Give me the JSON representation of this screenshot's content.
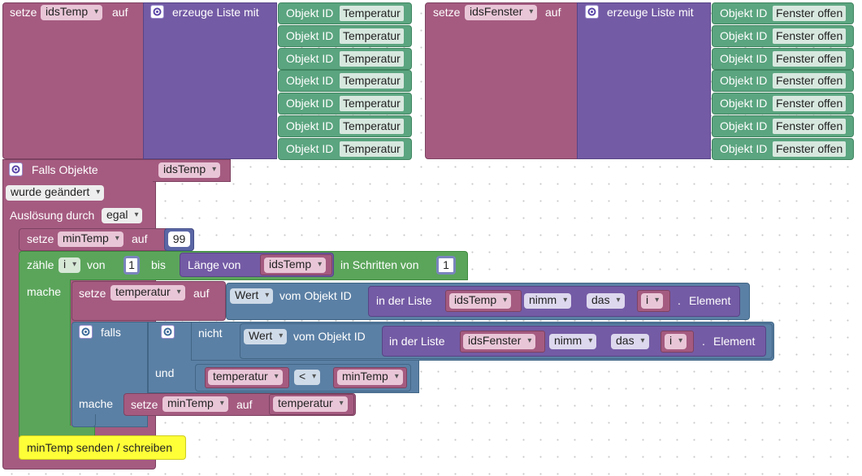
{
  "block_set_ids_temp": {
    "setze": "setze",
    "var": "idsTemp",
    "auf": "auf",
    "create_list": "erzeuge Liste mit",
    "items": [
      {
        "label": "Objekt ID",
        "value": "Temperatur"
      },
      {
        "label": "Objekt ID",
        "value": "Temperatur"
      },
      {
        "label": "Objekt ID",
        "value": "Temperatur"
      },
      {
        "label": "Objekt ID",
        "value": "Temperatur"
      },
      {
        "label": "Objekt ID",
        "value": "Temperatur"
      },
      {
        "label": "Objekt ID",
        "value": "Temperatur"
      },
      {
        "label": "Objekt ID",
        "value": "Temperatur"
      }
    ]
  },
  "block_set_ids_window": {
    "setze": "setze",
    "var": "idsFenster",
    "auf": "auf",
    "create_list": "erzeuge Liste mit",
    "items": [
      {
        "label": "Objekt ID",
        "value": "Fenster offen"
      },
      {
        "label": "Objekt ID",
        "value": "Fenster offen"
      },
      {
        "label": "Objekt ID",
        "value": "Fenster offen"
      },
      {
        "label": "Objekt ID",
        "value": "Fenster offen"
      },
      {
        "label": "Objekt ID",
        "value": "Fenster offen"
      },
      {
        "label": "Objekt ID",
        "value": "Fenster offen"
      },
      {
        "label": "Objekt ID",
        "value": "Fenster offen"
      }
    ]
  },
  "trigger": {
    "title": "Falls Objekte",
    "objects_var": "idsTemp",
    "changed": "wurde geändert",
    "triggered_by": "Auslösung durch",
    "triggered_by_value": "egal"
  },
  "set_min": {
    "setze": "setze",
    "var": "minTemp",
    "auf": "auf",
    "value": "99"
  },
  "count_loop": {
    "zaehle": "zähle",
    "var": "i",
    "von": "von",
    "from": "1",
    "bis": "bis",
    "length_of": "Länge von",
    "length_var": "idsTemp",
    "step_label": "in Schritten von",
    "step": "1",
    "mache": "mache"
  },
  "set_temp": {
    "setze": "setze",
    "var": "temperatur",
    "auf": "auf",
    "wert": "Wert",
    "vom_objekt": "vom Objekt ID",
    "in_list": "in der Liste",
    "list_var": "idsTemp",
    "take": "nimm",
    "the": "das",
    "index_var": "i",
    "element": "Element",
    "dot": "."
  },
  "if_block": {
    "falls": "falls",
    "nicht": "nicht",
    "wert": "Wert",
    "vom_objekt": "vom Objekt ID",
    "in_list": "in der Liste",
    "list_var": "idsFenster",
    "take": "nimm",
    "the": "das",
    "index_var": "i",
    "element": "Element",
    "dot": ".",
    "und": "und",
    "left": "temperatur",
    "op": "<",
    "right": "minTemp",
    "mache": "mache",
    "set_setze": "setze",
    "set_var": "minTemp",
    "set_auf": "auf",
    "set_value": "temperatur"
  },
  "send": {
    "label": "minTemp senden / schreiben"
  },
  "colors": {
    "variable": "#a55b80",
    "list": "#745ba5",
    "text": "#5ba580",
    "loop": "#5ba55b",
    "logic": "#5b80a5",
    "custom": "#ffff38"
  }
}
